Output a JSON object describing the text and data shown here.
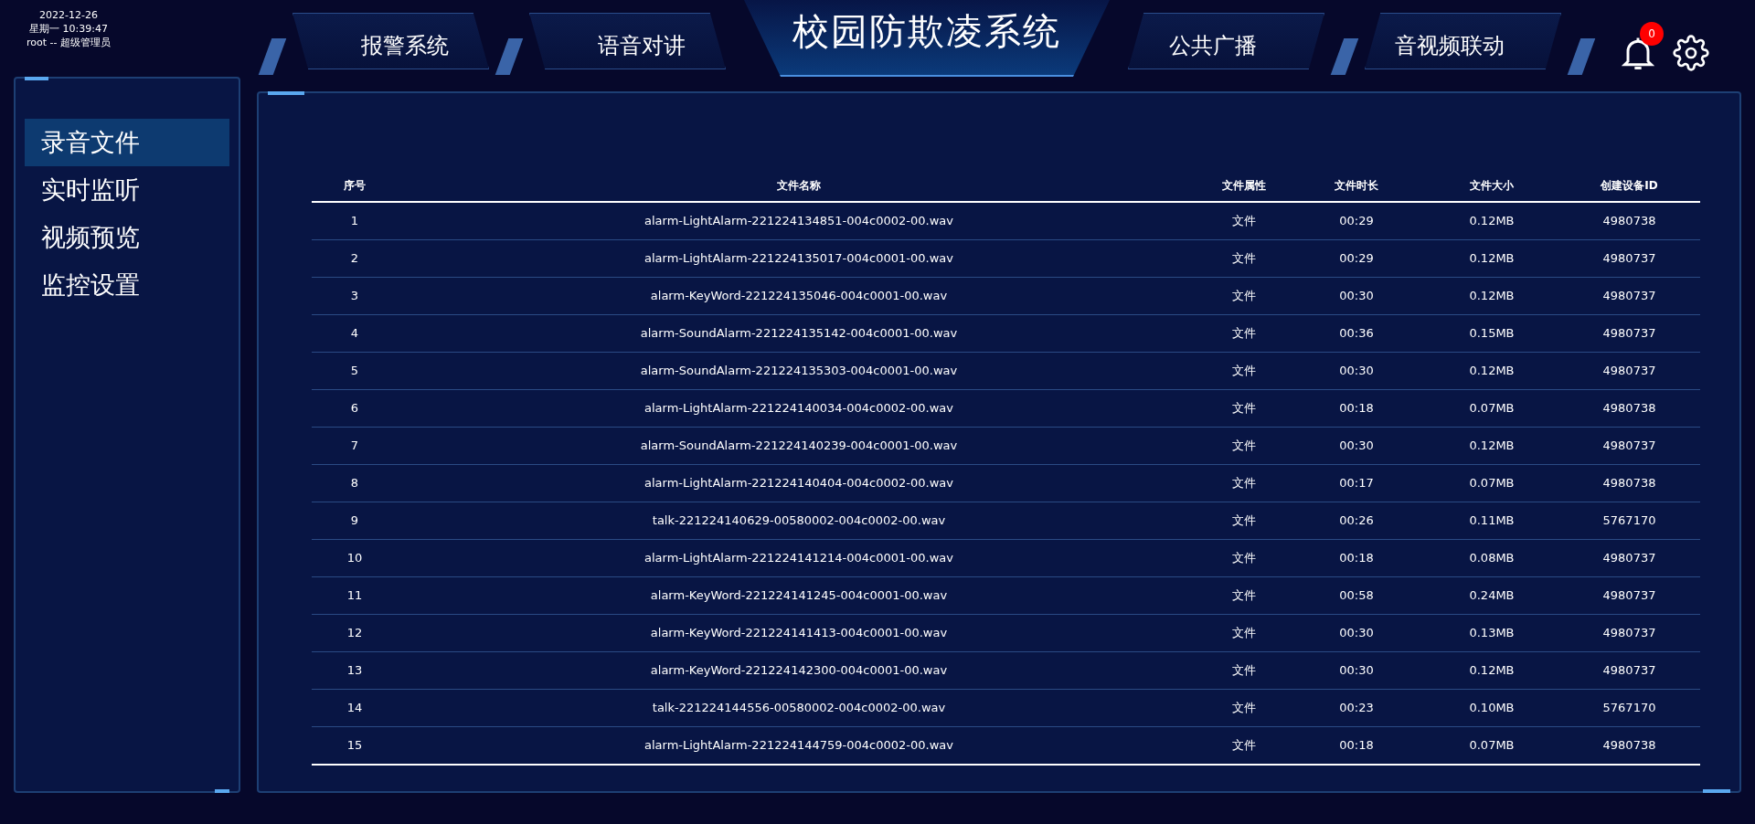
{
  "header": {
    "date": "2022-12-26",
    "weekday_time": "星期一 10:39:47",
    "user": "root -- 超级管理员"
  },
  "nav_left": [
    {
      "label": "报警系统",
      "selected": false
    },
    {
      "label": "语音对讲",
      "selected": false
    }
  ],
  "title": "校园防欺凌系统",
  "nav_right": [
    {
      "label": "公共广播",
      "selected": false
    },
    {
      "label": "音视频联动",
      "selected": false
    }
  ],
  "notifications": {
    "count": "0"
  },
  "sidebar": {
    "items": [
      {
        "label": "录音文件",
        "selected": true
      },
      {
        "label": "实时监听",
        "selected": false
      },
      {
        "label": "视频预览",
        "selected": false
      },
      {
        "label": "监控设置",
        "selected": false
      }
    ]
  },
  "table": {
    "columns": [
      "序号",
      "文件名称",
      "文件属性",
      "文件时长",
      "文件大小",
      "创建设备ID"
    ],
    "rows": [
      [
        "1",
        "alarm-LightAlarm-221224134851-004c0002-00.wav",
        "文件",
        "00:29",
        "0.12MB",
        "4980738"
      ],
      [
        "2",
        "alarm-LightAlarm-221224135017-004c0001-00.wav",
        "文件",
        "00:29",
        "0.12MB",
        "4980737"
      ],
      [
        "3",
        "alarm-KeyWord-221224135046-004c0001-00.wav",
        "文件",
        "00:30",
        "0.12MB",
        "4980737"
      ],
      [
        "4",
        "alarm-SoundAlarm-221224135142-004c0001-00.wav",
        "文件",
        "00:36",
        "0.15MB",
        "4980737"
      ],
      [
        "5",
        "alarm-SoundAlarm-221224135303-004c0001-00.wav",
        "文件",
        "00:30",
        "0.12MB",
        "4980737"
      ],
      [
        "6",
        "alarm-LightAlarm-221224140034-004c0002-00.wav",
        "文件",
        "00:18",
        "0.07MB",
        "4980738"
      ],
      [
        "7",
        "alarm-SoundAlarm-221224140239-004c0001-00.wav",
        "文件",
        "00:30",
        "0.12MB",
        "4980737"
      ],
      [
        "8",
        "alarm-LightAlarm-221224140404-004c0002-00.wav",
        "文件",
        "00:17",
        "0.07MB",
        "4980738"
      ],
      [
        "9",
        "talk-221224140629-00580002-004c0002-00.wav",
        "文件",
        "00:26",
        "0.11MB",
        "5767170"
      ],
      [
        "10",
        "alarm-LightAlarm-221224141214-004c0001-00.wav",
        "文件",
        "00:18",
        "0.08MB",
        "4980737"
      ],
      [
        "11",
        "alarm-KeyWord-221224141245-004c0001-00.wav",
        "文件",
        "00:58",
        "0.24MB",
        "4980737"
      ],
      [
        "12",
        "alarm-KeyWord-221224141413-004c0001-00.wav",
        "文件",
        "00:30",
        "0.13MB",
        "4980737"
      ],
      [
        "13",
        "alarm-KeyWord-221224142300-004c0001-00.wav",
        "文件",
        "00:30",
        "0.12MB",
        "4980737"
      ],
      [
        "14",
        "talk-221224144556-00580002-004c0002-00.wav",
        "文件",
        "00:23",
        "0.10MB",
        "5767170"
      ],
      [
        "15",
        "alarm-LightAlarm-221224144759-004c0002-00.wav",
        "文件",
        "00:18",
        "0.07MB",
        "4980738"
      ]
    ]
  }
}
